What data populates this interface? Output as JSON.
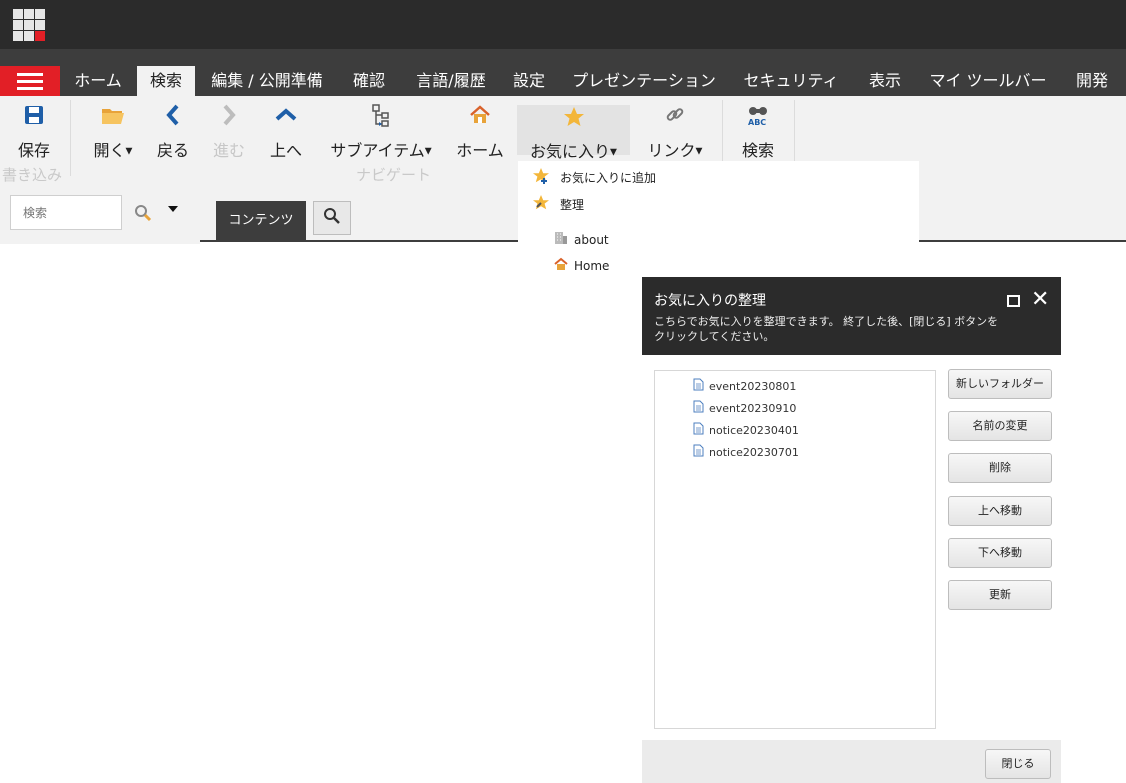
{
  "ribbon_tabs": [
    {
      "label": "ホーム"
    },
    {
      "label": "検索",
      "active": true
    },
    {
      "label": "編集 / 公開準備"
    },
    {
      "label": "確認"
    },
    {
      "label": "言語/履歴"
    },
    {
      "label": "設定"
    },
    {
      "label": "プレゼンテーション"
    },
    {
      "label": "セキュリティ"
    },
    {
      "label": "表示"
    },
    {
      "label": "マイ ツールバー"
    },
    {
      "label": "開発"
    }
  ],
  "ribbon": {
    "save": "保存",
    "open": "開く",
    "back": "戻る",
    "forward": "進む",
    "up": "上へ",
    "subitems": "サブアイテム",
    "home": "ホーム",
    "favorites": "お気に入り",
    "links": "リンク",
    "search": "検索",
    "group_write": "書き込み",
    "group_navigate": "ナビゲート"
  },
  "left_search": {
    "placeholder": "検索"
  },
  "content_tab": "コンテンツ",
  "favorites_menu": {
    "add": "お気に入りに追加",
    "organize": "整理",
    "items": [
      "about",
      "Home"
    ]
  },
  "dialog": {
    "title": "お気に入りの整理",
    "subtitle": "こちらでお気に入りを整理できます。 終了した後、[閉じる] ボタンをクリックしてください。",
    "items": [
      "event20230801",
      "event20230910",
      "notice20230401",
      "notice20230701"
    ],
    "buttons": [
      "新しいフォルダー",
      "名前の変更",
      "削除",
      "上へ移動",
      "下へ移動",
      "更新"
    ],
    "close": "閉じる"
  },
  "colors": {
    "accent": "#e21f26",
    "dark": "#2b2b2b",
    "tabbar": "#3d3d3d",
    "ribbon": "#f2f2f2"
  }
}
